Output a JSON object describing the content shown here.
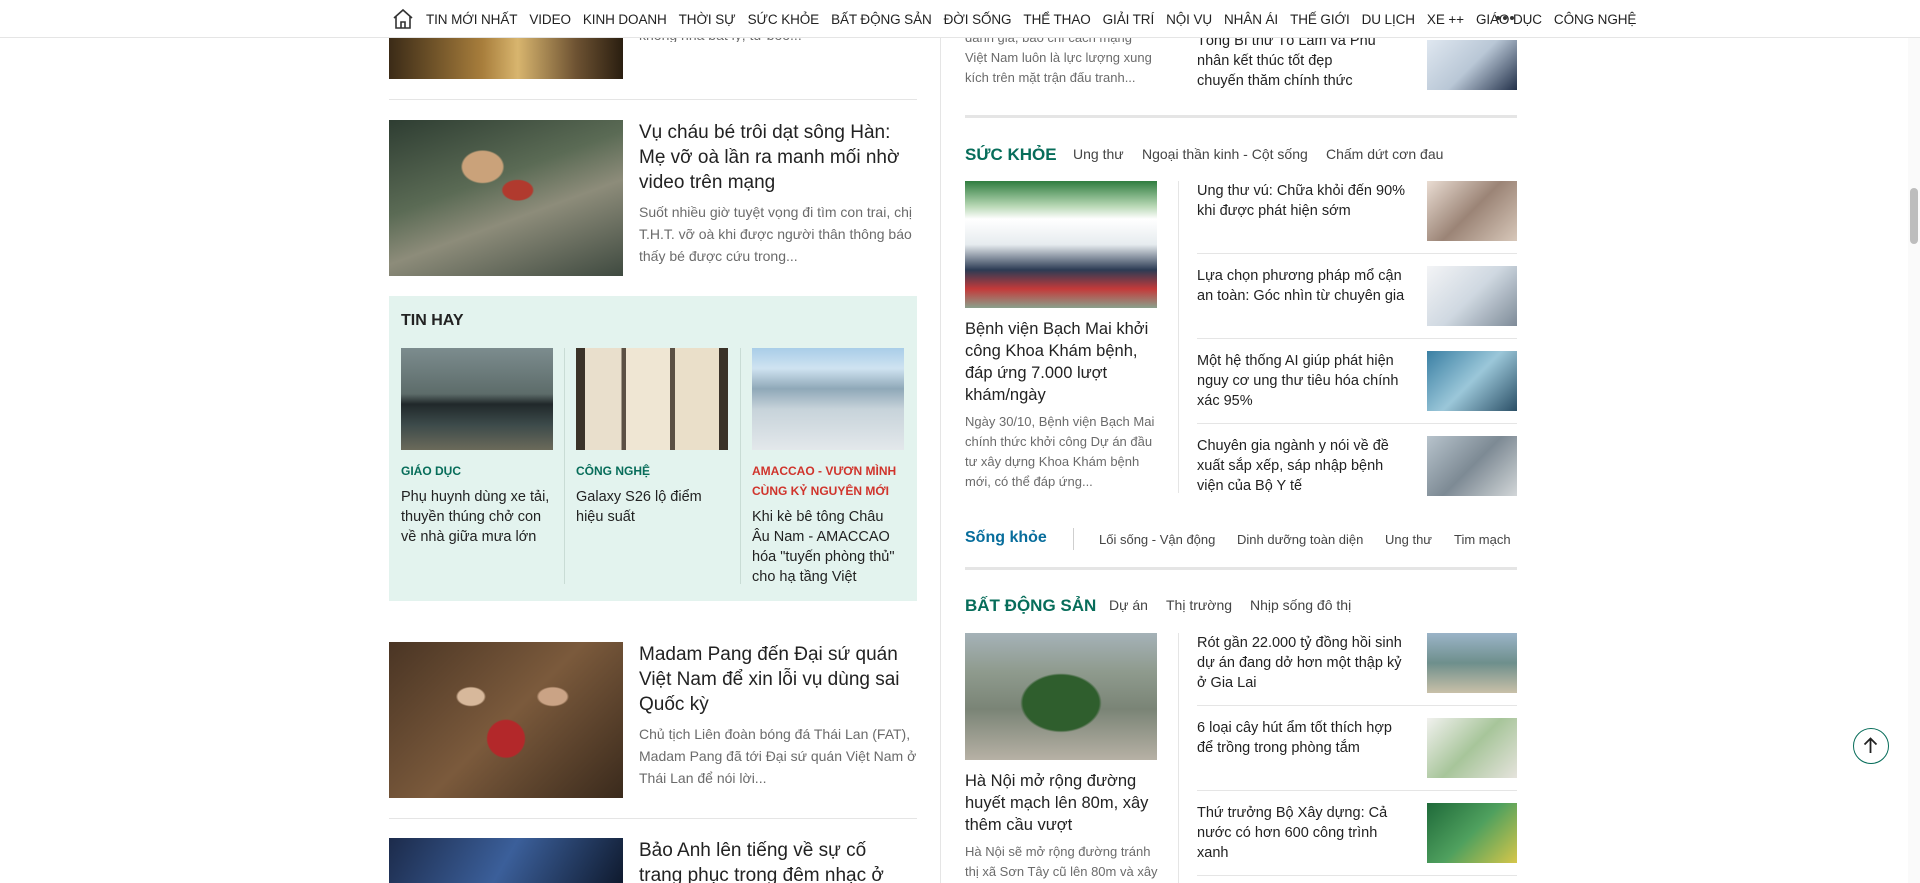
{
  "nav": {
    "items": [
      "TIN MỚI NHẤT",
      "VIDEO",
      "KINH DOANH",
      "THỜI SỰ",
      "SỨC KHỎE",
      "BẤT ĐỘNG SẢN",
      "ĐỜI SỐNG",
      "THỂ THAO",
      "GIẢI TRÍ",
      "NỘI VỤ",
      "NHÂN ÁI",
      "THẾ GIỚI",
      "DU LỊCH",
      "XE ++",
      "GIÁO DỤC",
      "CÔNG NGHỆ"
    ],
    "home_icon": "home-icon",
    "more_icon": "more-dots-icon"
  },
  "left": {
    "article_top_sum_tail": "không nhà bất lý, tư bôô...",
    "article1": {
      "title": "Vụ cháu bé trôi dạt sông Hàn: Mẹ vỡ oà lần ra manh mối nhờ video trên mạng",
      "summary": "Suốt nhiều giờ tuyệt vọng đi tìm con trai, chị T.H.T. vỡ oà khi được người thân thông báo thấy bé được cứu trong..."
    },
    "tinhay": {
      "heading": "TIN HAY",
      "items": [
        {
          "category": "GIÁO DỤC",
          "title": "Phụ huynh dùng xe tải, thuyền thúng chở con về nhà giữa mưa lớn",
          "cat_color": "#076d5a"
        },
        {
          "category": "CÔNG NGHỆ",
          "title": "Galaxy S26 lộ điểm hiệu suất",
          "cat_color": "#076d5a"
        },
        {
          "category": "AMACCAO - VƯƠN MÌNH CÙNG KỶ NGUYÊN MỚI",
          "title": "Khi kè bê tông Châu Âu Nam - AMACCAO hóa \"tuyến phòng thủ\" cho hạ tầng Việt",
          "cat_color": "#d0342c"
        }
      ]
    },
    "article2": {
      "title": "Madam Pang đến Đại sứ quán Việt Nam để xin lỗi vụ dùng sai Quốc kỳ",
      "summary": "Chủ tịch Liên đoàn bóng đá Thái Lan (FAT), Madam Pang đã tới Đại sứ quán Việt Nam ở Thái Lan để nói lời..."
    },
    "article3": {
      "title": "Bảo Anh lên tiếng về sự cố trang phục trong đêm nhạc ở"
    }
  },
  "right": {
    "top_left_tail": "danh giá, báo chí cách mạng Việt Nam luôn là lực lượng xung kích trên mặt trận đấu tranh...",
    "top_right_title": "Tổng Bí thư Tô Lâm và Phu nhân kết thúc tốt đẹp chuyến thăm chính thức Anh",
    "suckhoe": {
      "title": "SỨC KHỎE",
      "subs": [
        "Ung thư",
        "Ngoại thần kinh - Cột sống",
        "Chấm dứt cơn đau"
      ],
      "main_title": "Bệnh viện Bạch Mai khởi công Khoa Khám bệnh, đáp ứng 7.000 lượt khám/ngày",
      "main_sum": "Ngày 30/10, Bệnh viện Bạch Mai chính thức khởi công Dự án đầu tư xây dựng Khoa Khám bệnh mới, có thể đáp ứng...",
      "list": [
        "Ung thư vú: Chữa khỏi đến 90% khi được phát hiện sớm",
        "Lựa chọn phương pháp mổ cận an toàn: Góc nhìn từ chuyên gia",
        "Một hệ thống AI giúp phát hiện nguy cơ ung thư tiêu hóa chính xác 95%",
        "Chuyên gia ngành y nói về đề xuất sắp xếp, sáp nhập bệnh viện của Bộ Y tế"
      ]
    },
    "songkhoe": {
      "title": "Sống khỏe",
      "links": [
        "Lối sống - Vận động",
        "Dinh dưỡng toàn diện",
        "Ung thư",
        "Tim mạch"
      ]
    },
    "batdongsan": {
      "title": "BẤT ĐỘNG SẢN",
      "subs": [
        "Dự án",
        "Thị trường",
        "Nhịp sống đô thị"
      ],
      "main_title": "Hà Nội mở rộng đường huyết mạch lên 80m, xây thêm cầu vượt",
      "main_sum": "Hà Nội sẽ mở rộng đường tránh thị xã Sơn Tây cũ lên 80m và xây",
      "list": [
        "Rót gần 22.000 tỷ đồng hồi sinh dự án đang dở hơn một thập kỷ ở Gia Lai",
        "6 loại cây hút ẩm tốt thích hợp để trồng trong phòng tắm",
        "Thứ trưởng Bộ Xây dựng: Cả nước có hơn 600 công trình xanh"
      ]
    }
  },
  "colors": {
    "accent": "#076d5a",
    "songkhoe": "#076d9c",
    "promo": "#d0342c",
    "tinhay_bg": "#e3f3ee"
  }
}
